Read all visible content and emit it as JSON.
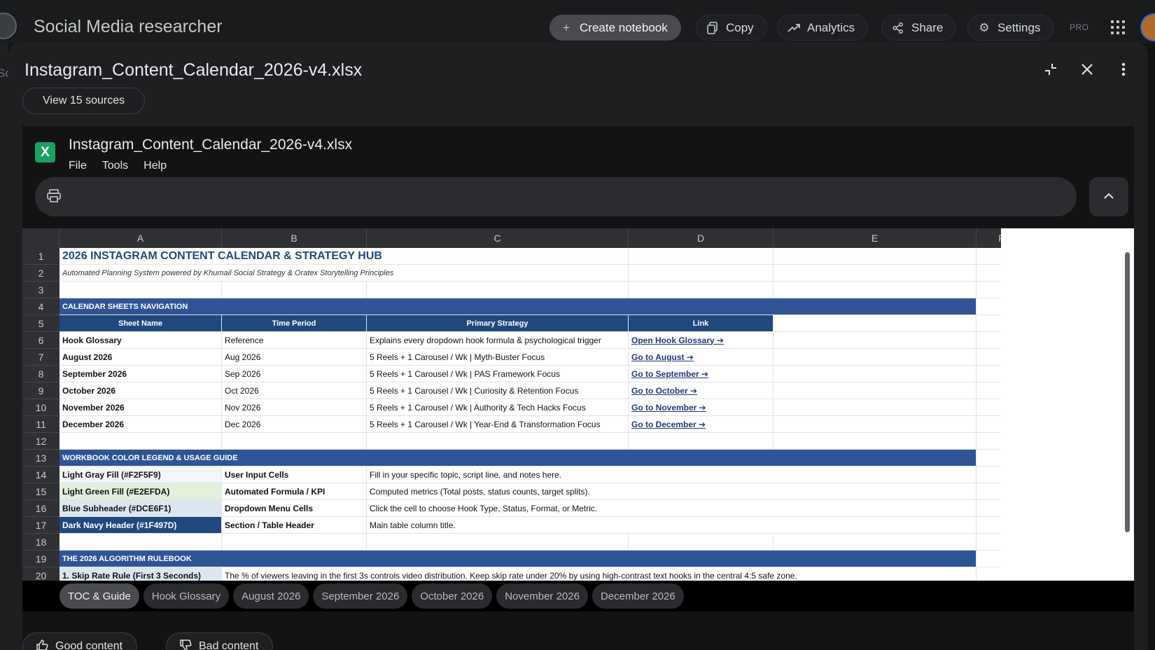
{
  "app": {
    "title": "Social Media researcher"
  },
  "topbar": {
    "create": "Create notebook",
    "copy": "Copy",
    "analytics": "Analytics",
    "share": "Share",
    "settings": "Settings",
    "pro": "PRO"
  },
  "background": {
    "left_text": "Sc"
  },
  "panel": {
    "title": "Instagram_Content_Calendar_2026-v4.xlsx",
    "sources": "View 15 sources"
  },
  "viewer": {
    "file_badge": "X",
    "title": "Instagram_Content_Calendar_2026-v4.xlsx",
    "menus": [
      "File",
      "Tools",
      "Help"
    ]
  },
  "sheet": {
    "columns": [
      "A",
      "B",
      "C",
      "D",
      "E",
      "F"
    ],
    "rows": [
      "1",
      "2",
      "3",
      "4",
      "5",
      "6",
      "7",
      "8",
      "9",
      "10",
      "11",
      "12",
      "13",
      "14",
      "15",
      "16",
      "17",
      "18",
      "19",
      "20"
    ],
    "title": "2026 INSTAGRAM CONTENT CALENDAR & STRATEGY HUB",
    "subtitle": "Automated Planning System powered by Khumail Social Strategy & Oratex Storytelling Principles",
    "nav_header": "CALENDAR SHEETS NAVIGATION",
    "nav_columns": [
      "Sheet Name",
      "Time Period",
      "Primary Strategy",
      "Link"
    ],
    "nav_rows": [
      {
        "name": "Hook Glossary",
        "period": "Reference",
        "strategy": "Explains every dropdown hook formula & psychological trigger",
        "link": "Open Hook Glossary ➔"
      },
      {
        "name": "August 2026",
        "period": "Aug 2026",
        "strategy": "5 Reels + 1 Carousel / Wk | Myth-Buster Focus",
        "link": "Go to August ➔"
      },
      {
        "name": "September 2026",
        "period": "Sep 2026",
        "strategy": "5 Reels + 1 Carousel / Wk | PAS Framework Focus",
        "link": "Go to September ➔"
      },
      {
        "name": "October 2026",
        "period": "Oct 2026",
        "strategy": "5 Reels + 1 Carousel / Wk | Curiosity & Retention Focus",
        "link": "Go to October ➔"
      },
      {
        "name": "November 2026",
        "period": "Nov 2026",
        "strategy": "5 Reels + 1 Carousel / Wk | Authority & Tech Hacks Focus",
        "link": "Go to November ➔"
      },
      {
        "name": "December 2026",
        "period": "Dec 2026",
        "strategy": "5 Reels + 1 Carousel / Wk | Year-End & Transformation Focus",
        "link": "Go to December ➔"
      }
    ],
    "legend_header": "WORKBOOK COLOR LEGEND & USAGE GUIDE",
    "legend_rows": [
      {
        "swatch": "Light Gray Fill (#F2F5F9)",
        "type": "User Input Cells",
        "desc": "Fill in your specific topic, script line, and notes here.",
        "color": "#f2f5f9"
      },
      {
        "swatch": "Light Green Fill (#E2EFDA)",
        "type": "Automated Formula / KPI",
        "desc": "Computed metrics (Total posts, status counts, target splits).",
        "color": "#e2efda"
      },
      {
        "swatch": "Blue Subheader (#DCE6F1)",
        "type": "Dropdown Menu Cells",
        "desc": "Click the cell to choose Hook Type, Status, Format, or Metric.",
        "color": "#dce6f1"
      },
      {
        "swatch": "Dark Navy Header (#1F497D)",
        "type": "Section / Table Header",
        "desc": "Main table column title.",
        "color": "#1f497d"
      }
    ],
    "rulebook_header": "THE 2026 ALGORITHM RULEBOOK",
    "rule_1_title": "1. Skip Rate Rule (First 3 Seconds)",
    "rule_1_desc": "The % of viewers leaving in the first 3s controls video distribution. Keep skip rate under 20% by using high-contrast text hooks in the central 4:5 safe zone."
  },
  "tabs": [
    "TOC & Guide",
    "Hook Glossary",
    "August 2026",
    "September 2026",
    "October 2026",
    "November 2026",
    "December 2026"
  ],
  "feedback": {
    "good": "Good content",
    "bad": "Bad content"
  },
  "colors": {
    "accent_navy": "#1f497d",
    "section_blue": "#2f5496",
    "excel_green": "#1aa260"
  }
}
